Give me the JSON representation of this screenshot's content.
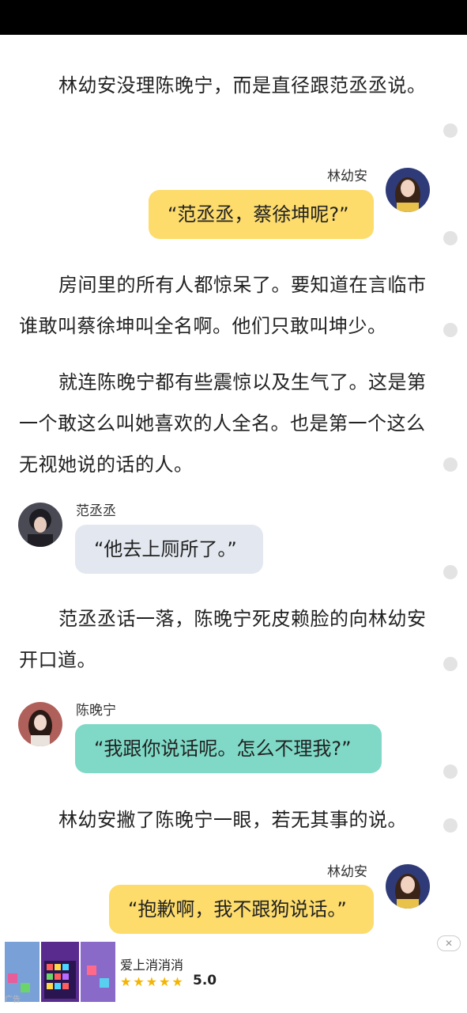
{
  "paragraphs": {
    "p1": "林幼安没理陈晚宁，而是直径跟范丞丞说。",
    "p2": "房间里的所有人都惊呆了。要知道在言临市谁敢叫蔡徐坤叫全名啊。他们只敢叫坤少。",
    "p3": "就连陈晚宁都有些震惊以及生气了。这是第一个敢这么叫她喜欢的人全名。也是第一个这么无视她说的话的人。",
    "p4": "范丞丞话一落，陈晚宁死皮赖脸的向林幼安开口道。",
    "p5": "林幼安撇了陈晚宁一眼，若无其事的说。"
  },
  "dialogs": {
    "d1": {
      "name": "林幼安",
      "text": "“范丞丞，蔡徐坤呢?”"
    },
    "d2": {
      "name": "范丞丞",
      "text": "“他去上厕所了。”"
    },
    "d3": {
      "name": "陈晚宁",
      "text": "“我跟你说话呢。怎么不理我?”"
    },
    "d4": {
      "name": "林幼安",
      "text": "“抱歉啊，我不跟狗说话。”"
    }
  },
  "ad": {
    "title": "爱上消消消",
    "stars": "★★★★★",
    "rating": "5.0",
    "close_icon": "close-icon",
    "mark": "广告"
  },
  "colors": {
    "bubble_yellow": "#fddc6c",
    "bubble_gray": "#e3e8f0",
    "bubble_teal": "#7fd9c6"
  }
}
